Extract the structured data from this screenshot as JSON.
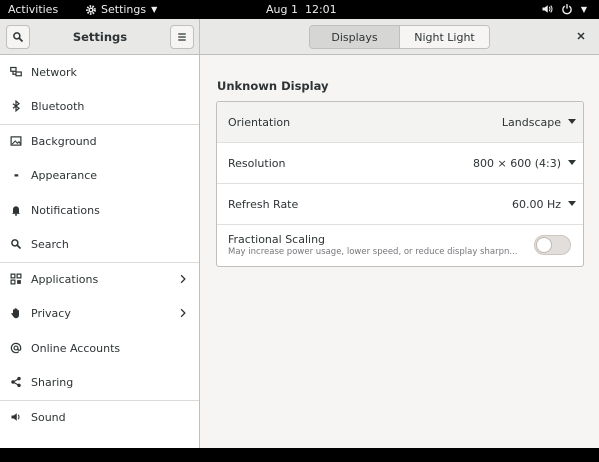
{
  "topbar": {
    "activities": "Activities",
    "app_name": "Settings",
    "clock": "Aug 1  12:01",
    "icons": [
      "gear-icon",
      "volume-icon",
      "power-icon"
    ]
  },
  "headerbar": {
    "title": "Settings",
    "tabs": [
      {
        "label": "Displays",
        "active": true
      },
      {
        "label": "Night Light",
        "active": false
      }
    ],
    "icons": [
      "search-icon",
      "menu-icon",
      "close-icon"
    ]
  },
  "sidebar": {
    "items": [
      {
        "label": "Network",
        "icon": "network-icon"
      },
      {
        "label": "Bluetooth",
        "icon": "bluetooth-icon"
      },
      {
        "label": "Background",
        "icon": "background-icon"
      },
      {
        "label": "Appearance",
        "icon": "appearance-icon"
      },
      {
        "label": "Notifications",
        "icon": "bell-icon"
      },
      {
        "label": "Search",
        "icon": "search-icon"
      },
      {
        "label": "Applications",
        "icon": "applications-icon",
        "has_submenu": true
      },
      {
        "label": "Privacy",
        "icon": "hand-icon",
        "has_submenu": true
      },
      {
        "label": "Online Accounts",
        "icon": "at-icon"
      },
      {
        "label": "Sharing",
        "icon": "share-icon"
      },
      {
        "label": "Sound",
        "icon": "speaker-icon"
      }
    ]
  },
  "display": {
    "section_title": "Unknown Display",
    "orientation": {
      "label": "Orientation",
      "value": "Landscape"
    },
    "resolution": {
      "label": "Resolution",
      "value": "800 × 600 (4:3)"
    },
    "refresh_rate": {
      "label": "Refresh Rate",
      "value": "60.00 Hz"
    },
    "fractional_scaling": {
      "label": "Fractional Scaling",
      "subtitle": "May increase power usage, lower speed, or reduce display sharpn...",
      "enabled": false
    }
  },
  "colors": {
    "accent": "#3584e4",
    "headerbar": "#e8e8e7",
    "sidebar_bg": "#ffffff",
    "window_bg": "#f6f5f4"
  }
}
